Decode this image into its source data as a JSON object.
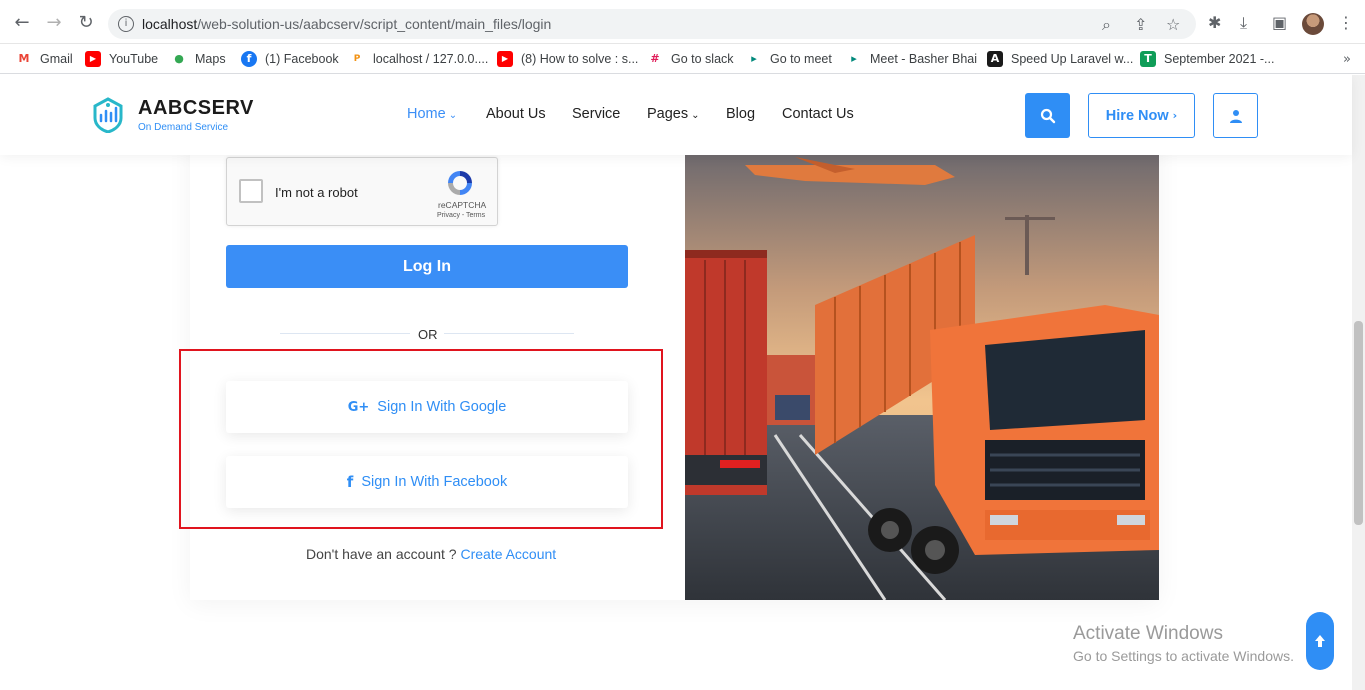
{
  "browser": {
    "url_host": "localhost",
    "url_path": "/web-solution-us/aabcserv/script_content/main_files/login",
    "bookmarks": [
      {
        "label": "Gmail",
        "icon": "gmail-icon",
        "color": "#ea4335",
        "glyph": "M"
      },
      {
        "label": "YouTube",
        "icon": "youtube-icon",
        "color": "#ff0000",
        "glyph": "▶"
      },
      {
        "label": "Maps",
        "icon": "maps-icon",
        "color": "#34a853",
        "glyph": "●"
      },
      {
        "label": "(1) Facebook",
        "icon": "facebook-icon",
        "color": "#1877f2",
        "glyph": "f"
      },
      {
        "label": "localhost / 127.0.0....",
        "icon": "phpmyadmin-icon",
        "color": "#f29111",
        "glyph": "P"
      },
      {
        "label": "(8) How to solve : s...",
        "icon": "youtube-icon",
        "color": "#ff0000",
        "glyph": "▶"
      },
      {
        "label": "Go to slack",
        "icon": "slack-icon",
        "color": "#e01e5a",
        "glyph": "#"
      },
      {
        "label": "Go to meet",
        "icon": "meet-icon",
        "color": "#00897b",
        "glyph": "▸"
      },
      {
        "label": "Meet - Basher Bhai",
        "icon": "meet-icon",
        "color": "#00897b",
        "glyph": "▸"
      },
      {
        "label": "Speed Up Laravel w...",
        "icon": "laravel-icon",
        "color": "#1a1a1a",
        "glyph": "A"
      },
      {
        "label": "September 2021 -...",
        "icon": "sheets-icon",
        "color": "#0f9d58",
        "glyph": "T"
      }
    ],
    "more_bookmarks": "»"
  },
  "site": {
    "logo_title": "AABCSERV",
    "logo_subtitle": "On Demand Service",
    "nav": {
      "home": "Home",
      "about": "About Us",
      "service": "Service",
      "pages": "Pages",
      "blog": "Blog",
      "contact": "Contact Us"
    },
    "hire_label": "Hire Now",
    "accent": "#2f8ef5"
  },
  "login": {
    "captcha_label": "I'm not a robot",
    "captcha_brand": "reCAPTCHA",
    "captcha_links": "Privacy - Terms",
    "login_label": "Log In",
    "or_label": "OR",
    "google_label": "Sign In With Google",
    "facebook_label": "Sign In With Facebook",
    "no_account": "Don't have an account ?",
    "create_account": "Create Account"
  },
  "os": {
    "activate_title": "Activate Windows",
    "activate_sub": "Go to Settings to activate Windows."
  }
}
